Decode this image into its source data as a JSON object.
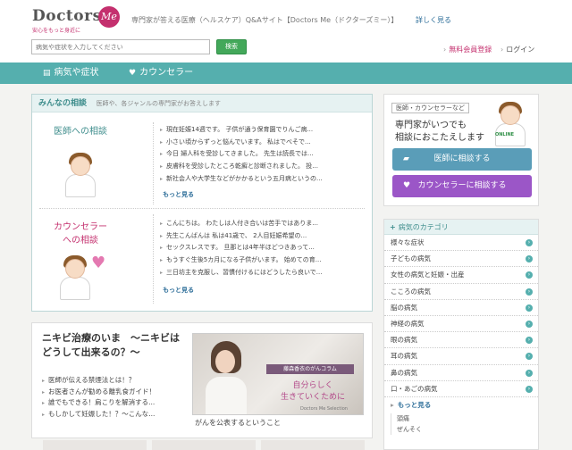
{
  "header": {
    "logo_text": "Doctors",
    "logo_badge": "Me",
    "logo_tagline": "安心をもっと身近に",
    "site_description": "専門家が答える医療（ヘルスケア）Q&Aサイト【Doctors Me（ドクターズミー）】",
    "more_link": "詳しく見る",
    "search_placeholder": "病気や症状を入力してください",
    "search_button": "検索",
    "register_link": "無料会員登録",
    "login_link": "ログイン"
  },
  "nav": {
    "items": [
      {
        "icon": "▤",
        "label": "病気や症状"
      },
      {
        "icon": "♥",
        "label": "カウンセラー"
      }
    ]
  },
  "community": {
    "title": "みんなの相談",
    "subtitle": "医師や、各ジャンルの専門家がお答えします",
    "doctor": {
      "label": "医師への相談",
      "questions": [
        "現在妊娠14週です。 子供が通う保育園でりんご病...",
        "小さい頃からずっと悩んでいます。 私はでべそで...",
        "今日 婦人科を受診してきました。 先生は読長では...",
        "皮膚科を受診したところ乾癬と診断されました。 投...",
        "新社会人や大学生などがかかるという五月病というの..."
      ],
      "more": "もっと見る"
    },
    "counselor": {
      "label_line1": "カウンセラー",
      "label_line2": "への相談",
      "questions": [
        "こんにちは。 わたしは人付き合いは苦手ではありま...",
        "先生こんばんは 私は41歳で、 2人目妊娠希望の...",
        "セックスレスです。 旦那とは4年半ほどつきあって...",
        "もうすぐ生後5カ月になる子供がいます。 始めての育...",
        "三日坊主を克服し、習慣付けるにはどうしたら良いで..."
      ],
      "more": "もっと見る"
    }
  },
  "feature": {
    "title": "ニキビ治療のいま　～ニキビはどうして出来るの？～",
    "links": [
      "医師が伝える禁煙法とは！？",
      "お医者さんが勧める離乳食ガイド！",
      "誰でもできる！肩こりを解消する...",
      "もしかして妊娠した！？～こんな..."
    ],
    "banner": {
      "tag": "藤森香衣のがんコラム",
      "copy_line1": "自分らしく",
      "copy_line2": "生きていくために",
      "signature": "Doctors Me Selection",
      "caption": "がんを公表するということ"
    }
  },
  "promo": {
    "tag": "医師・カウンセラーなど",
    "headline_line1": "専門家がいつでも",
    "headline_line2": "相談におこたえします",
    "online_badge": "ONLINE",
    "doctor_button": "医師に相談する",
    "counselor_button": "カウンセラーに相談する"
  },
  "categories": {
    "title": "病気のカテゴリ",
    "items": [
      "様々な症状",
      "子どもの病気",
      "女性の病気と妊娠・出産",
      "こころの病気",
      "脳の病気",
      "神経の病気",
      "眼の病気",
      "耳の病気",
      "鼻の病気",
      "口・あごの病気"
    ],
    "more": "もっと見る",
    "subitems": [
      "頭痛",
      "ぜんそく"
    ]
  }
}
